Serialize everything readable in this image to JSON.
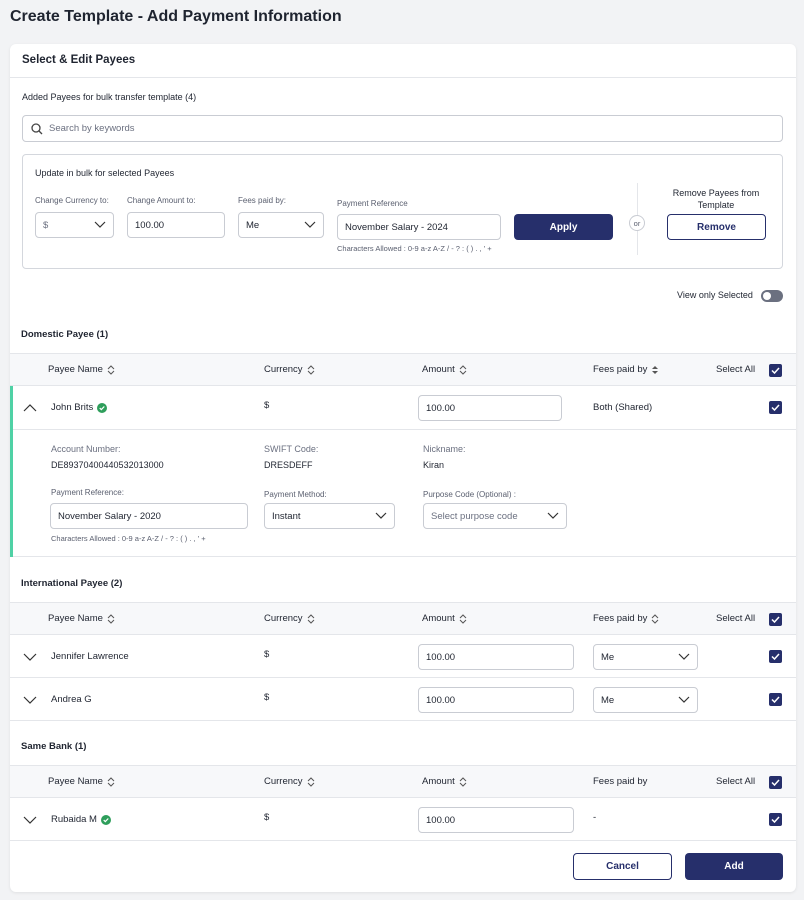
{
  "page_title": "Create Template - Add Payment Information",
  "card_title": "Select & Edit Payees",
  "added_payees_label": "Added Payees for bulk transfer template (4)",
  "search": {
    "placeholder": "Search by keywords"
  },
  "bulk": {
    "title": "Update in bulk for selected Payees",
    "currency_label": "Change Currency to:",
    "currency_value": "$",
    "amount_label": "Change Amount to:",
    "amount_value": "100.00",
    "fees_label": "Fees paid by:",
    "fees_value": "Me",
    "reference_label": "Payment Reference",
    "reference_value": "November Salary - 2024",
    "chars_allowed": "Characters Allowed : 0-9 a-z A-Z / - ? : ( ) . , ' +",
    "apply_label": "Apply",
    "or_label": "or",
    "remove_title": "Remove Payees from Template",
    "remove_label": "Remove"
  },
  "view_only_selected": "View only Selected",
  "columns": {
    "payee_name": "Payee Name",
    "currency": "Currency",
    "amount": "Amount",
    "fees_paid_by": "Fees paid by",
    "select_all": "Select All"
  },
  "domestic": {
    "title": "Domestic Payee (1)",
    "rows": [
      {
        "name": "John Brits",
        "currency": "$",
        "amount": "100.00",
        "fees": "Both (Shared)"
      }
    ],
    "details": {
      "account_label": "Account Number:",
      "account_value": "DE89370400440532013000",
      "swift_label": "SWIFT Code:",
      "swift_value": "DRESDEFF",
      "nickname_label": "Nickname:",
      "nickname_value": "Kiran",
      "ref_label": "Payment Reference:",
      "ref_value": "November Salary - 2020",
      "method_label": "Payment Method:",
      "method_value": "Instant",
      "purpose_label": "Purpose Code (Optional) :",
      "purpose_placeholder": "Select purpose code",
      "chars_allowed": "Characters Allowed : 0-9 a-z A-Z / - ? : ( ) . , ' +"
    }
  },
  "international": {
    "title": "International Payee (2)",
    "rows": [
      {
        "name": "Jennifer Lawrence",
        "currency": "$",
        "amount": "100.00",
        "fees": "Me"
      },
      {
        "name": "Andrea G",
        "currency": "$",
        "amount": "100.00",
        "fees": "Me"
      }
    ]
  },
  "same_bank": {
    "title": "Same Bank (1)",
    "rows": [
      {
        "name": "Rubaida M",
        "currency": "$",
        "amount": "100.00",
        "fees": "-"
      }
    ]
  },
  "footer": {
    "cancel_label": "Cancel",
    "add_label": "Add"
  },
  "colors": {
    "primary": "#262f6b",
    "accent": "#4fd1a5",
    "verified": "#2e9e5b"
  }
}
